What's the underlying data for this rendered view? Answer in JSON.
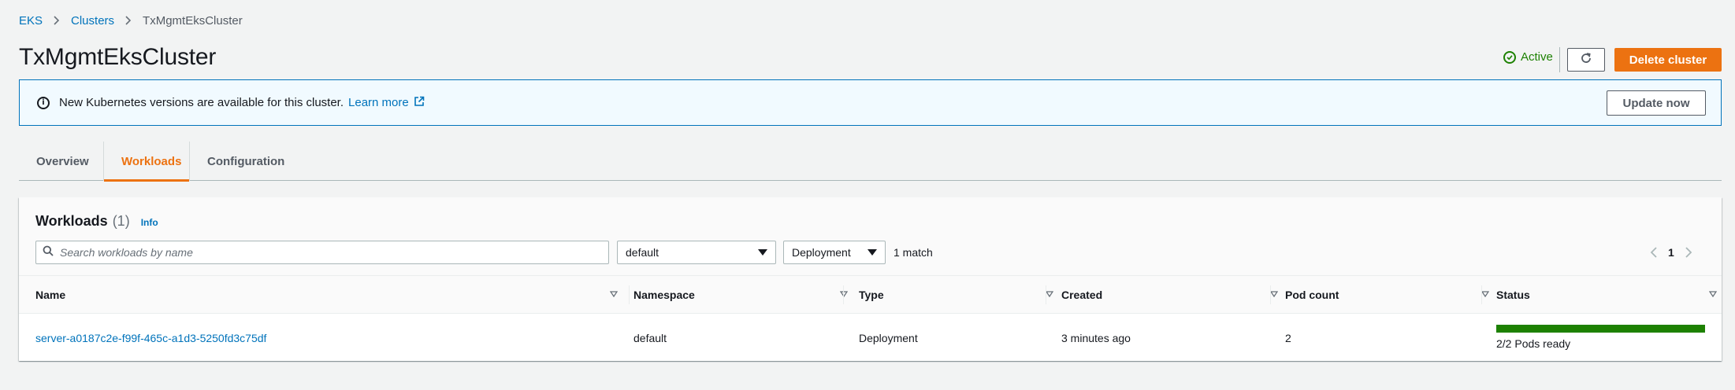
{
  "breadcrumb": {
    "items": [
      "EKS",
      "Clusters"
    ],
    "current": "TxMgmtEksCluster"
  },
  "header": {
    "title": "TxMgmtEksCluster",
    "status": "Active",
    "delete_label": "Delete cluster"
  },
  "banner": {
    "text": "New Kubernetes versions are available for this cluster.",
    "link": "Learn more",
    "button": "Update now"
  },
  "tabs": [
    {
      "label": "Overview"
    },
    {
      "label": "Workloads",
      "active": true
    },
    {
      "label": "Configuration"
    }
  ],
  "workloads": {
    "title": "Workloads",
    "count": "(1)",
    "info": "Info",
    "search_placeholder": "Search workloads by name",
    "namespace_select": "default",
    "type_select": "Deployment",
    "match_text": "1 match",
    "page": "1",
    "columns": [
      "Name",
      "Namespace",
      "Type",
      "Created",
      "Pod count",
      "Status"
    ],
    "rows": [
      {
        "name": "server-a0187c2e-f99f-465c-a1d3-5250fd3c75df",
        "namespace": "default",
        "type": "Deployment",
        "created": "3 minutes ago",
        "pod_count": "2",
        "status": "2/2 Pods ready",
        "ready_fraction": 1.0
      }
    ]
  },
  "colors": {
    "accent": "#ec7211",
    "link": "#0073bb",
    "success": "#1d8102"
  }
}
